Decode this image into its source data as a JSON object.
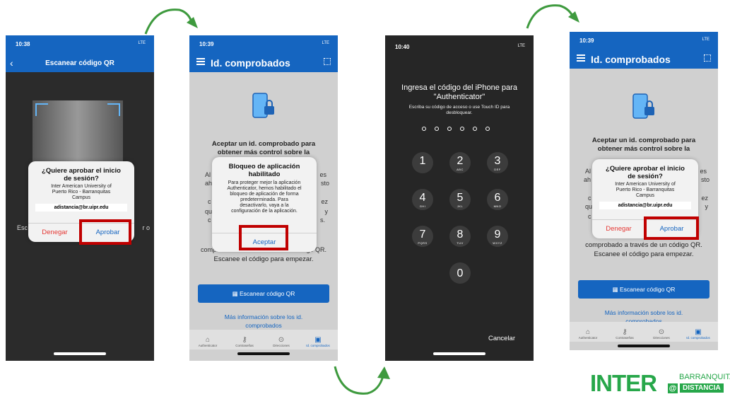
{
  "phone1": {
    "time": "10:38",
    "signal": "LTE",
    "title": "Escanear código QR",
    "bg_left": "Esc",
    "bg_right": "r o",
    "dialog": {
      "title_line1": "¿Quiere aprobar el inicio",
      "title_line2": "de sesión?",
      "org_line1": "Inter American University of",
      "org_line2": "Puerto Rico - Barranquitas",
      "org_line3": "Campus",
      "email": "adistancia@br.uipr.edu",
      "deny": "Denegar",
      "approve": "Aprobar"
    }
  },
  "phone2": {
    "time": "10:39",
    "signal": "LTE",
    "title": "Id. comprobados",
    "heading_line1": "Aceptar un id. comprobado para",
    "heading_line2": "obtener más control sobre la",
    "frag_left1": "Al",
    "frag_left2": "ah",
    "frag_left3": "c",
    "frag_left4": "qu",
    "frag_left5": "c",
    "frag_right1": "es",
    "frag_right2": "sto",
    "frag_right3": "ez",
    "frag_right4": "y",
    "frag_right5": "s.",
    "body_line1_a": "comprob",
    "body_line1_b": "código QR.",
    "body_line2": "Escanee el código para empezar.",
    "dialog": {
      "title_line1": "Bloqueo de aplicación",
      "title_line2": "habilitado",
      "line1": "Para proteger mejor la aplicación",
      "line2": "Authenticator, hemos habilitado el",
      "line3": "bloqueo de aplicación de forma",
      "line4": "predeterminada. Para",
      "line5": "desactivarlo, vaya a la",
      "line6": "configuración de la aplicación.",
      "accept": "Aceptar"
    },
    "scan_button": "Escanear código QR",
    "more_info_line1": "Más información sobre los id.",
    "more_info_line2": "comprobados",
    "nav": [
      "Authenticator",
      "Contraseñas",
      "Direcciones",
      "Id. comprobados"
    ]
  },
  "phone3": {
    "time": "10:40",
    "signal": "LTE",
    "prompt_line1": "Ingresa el código del iPhone para",
    "prompt_line2": "\"Authenticator\"",
    "hint_line1": "Escriba su código de acceso o use Touch ID para",
    "hint_line2": "desbloquear.",
    "keys": [
      {
        "d": "1",
        "l": ""
      },
      {
        "d": "2",
        "l": "ABC"
      },
      {
        "d": "3",
        "l": "DEF"
      },
      {
        "d": "4",
        "l": "GHI"
      },
      {
        "d": "5",
        "l": "JKL"
      },
      {
        "d": "6",
        "l": "MNO"
      },
      {
        "d": "7",
        "l": "PQRS"
      },
      {
        "d": "8",
        "l": "TUV"
      },
      {
        "d": "9",
        "l": "WXYZ"
      },
      {
        "d": "0",
        "l": ""
      }
    ],
    "cancel": "Cancelar"
  },
  "phone4": {
    "time": "10:39",
    "signal": "LTE",
    "title": "Id. comprobados",
    "heading_line1": "Aceptar un id. comprobado para",
    "heading_line2": "obtener más control sobre la",
    "frag_left1": "Al",
    "frag_left2": "ah",
    "frag_left3": "c",
    "frag_left4": "qu",
    "frag_left5": "c",
    "frag_right1": "es",
    "frag_right2": "sto",
    "frag_right3": "ez",
    "frag_right4": "y",
    "body_line1": "comprobado a través de un código QR.",
    "body_line2": "Escanee el código para empezar.",
    "dialog": {
      "title_line1": "¿Quiere aprobar el inicio",
      "title_line2": "de sesión?",
      "org_line1": "Inter American University of",
      "org_line2": "Puerto Rico - Barranquitas",
      "org_line3": "Campus",
      "email": "adistancia@br.uipr.edu",
      "deny": "Denegar",
      "approve": "Aprobar"
    },
    "scan_button": "Escanear código QR",
    "more_info_line1": "Más información sobre los id.",
    "more_info_line2": "comprobados",
    "nav": [
      "Authenticator",
      "Contraseñas",
      "Direcciones",
      "Id. comprobados"
    ]
  },
  "logo": {
    "inter": "INTER",
    "barranquitas": "BARRANQUITAS",
    "at": "@",
    "distancia": "DISTANCIA"
  },
  "colors": {
    "brand_blue": "#1565c0",
    "highlight_red": "#c00000",
    "arrow_green": "#3e9a3e",
    "logo_green": "#27a74a"
  }
}
